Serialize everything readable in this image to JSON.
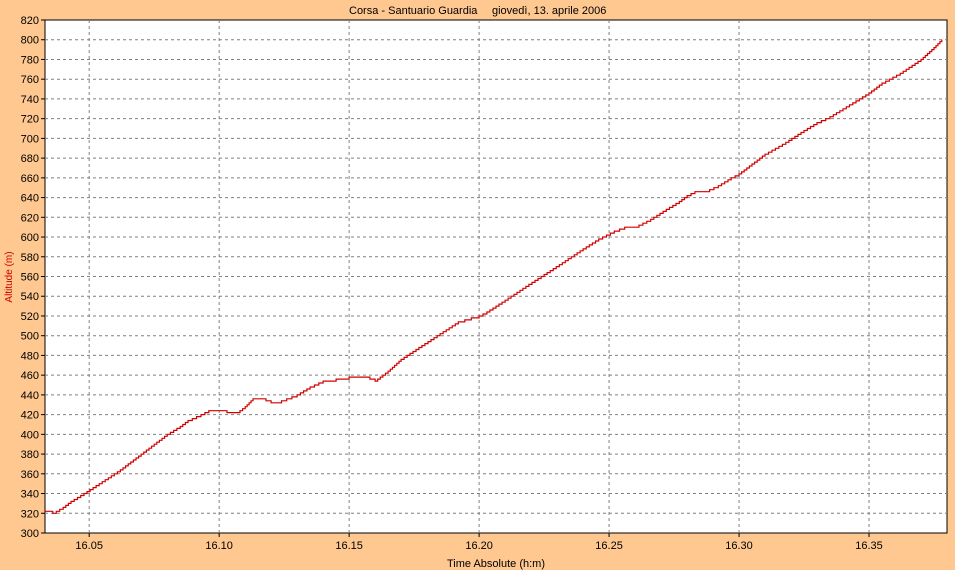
{
  "window": {
    "title_left": "Corsa - Santuario Guardia",
    "title_right": "giovedì, 13. aprile 2006"
  },
  "colors": {
    "background": "#FFC890",
    "plot_area": "#FFFFFF",
    "series": "#D00000",
    "grid": "#808080",
    "ylabel": "#CC0000",
    "text": "#000000"
  },
  "chart_data": {
    "type": "line",
    "title": "Corsa - Santuario Guardia      giovedì, 13. aprile 2006",
    "xlabel": "Time Absolute (h:m)",
    "ylabel": "Altitude (m)",
    "xlim": [
      16.033,
      16.38
    ],
    "ylim": [
      300,
      820
    ],
    "x_ticks": [
      16.05,
      16.1,
      16.15,
      16.2,
      16.25,
      16.3,
      16.35
    ],
    "x_tick_labels": [
      "16.05",
      "16.10",
      "16.15",
      "16.20",
      "16.25",
      "16.30",
      "16.35"
    ],
    "y_ticks": [
      300,
      320,
      340,
      360,
      380,
      400,
      420,
      440,
      460,
      480,
      500,
      520,
      540,
      560,
      580,
      600,
      620,
      640,
      660,
      680,
      700,
      720,
      740,
      760,
      780,
      800,
      820
    ],
    "grid": true,
    "series": [
      {
        "x": [
          16.033,
          16.036,
          16.04,
          16.043,
          16.048,
          16.055,
          16.062,
          16.068,
          16.075,
          16.08,
          16.085,
          16.088,
          16.093,
          16.096,
          16.1,
          16.103,
          16.107,
          16.11,
          16.113,
          16.116,
          16.12,
          16.124,
          16.13,
          16.135,
          16.14,
          16.145,
          16.15,
          16.155,
          16.158,
          16.16,
          16.165,
          16.17,
          16.178,
          16.185,
          16.192,
          16.197,
          16.2,
          16.203,
          16.21,
          16.218,
          16.225,
          16.232,
          16.24,
          16.246,
          16.252,
          16.256,
          16.26,
          16.266,
          16.272,
          16.277,
          16.28,
          16.283,
          16.287,
          16.292,
          16.297,
          16.3,
          16.303,
          16.31,
          16.318,
          16.325,
          16.33,
          16.335,
          16.34,
          16.345,
          16.35,
          16.355,
          16.362,
          16.37,
          16.375,
          16.378
        ],
        "y": [
          322,
          320,
          326,
          332,
          340,
          352,
          364,
          376,
          390,
          400,
          408,
          414,
          420,
          424,
          424,
          422,
          422,
          428,
          436,
          436,
          432,
          434,
          440,
          448,
          454,
          456,
          458,
          458,
          456,
          454,
          464,
          476,
          490,
          502,
          514,
          518,
          520,
          524,
          536,
          550,
          562,
          574,
          588,
          598,
          606,
          610,
          610,
          618,
          628,
          636,
          642,
          646,
          646,
          652,
          660,
          664,
          670,
          684,
          696,
          708,
          716,
          722,
          730,
          738,
          746,
          756,
          766,
          780,
          792,
          800
        ]
      }
    ]
  }
}
